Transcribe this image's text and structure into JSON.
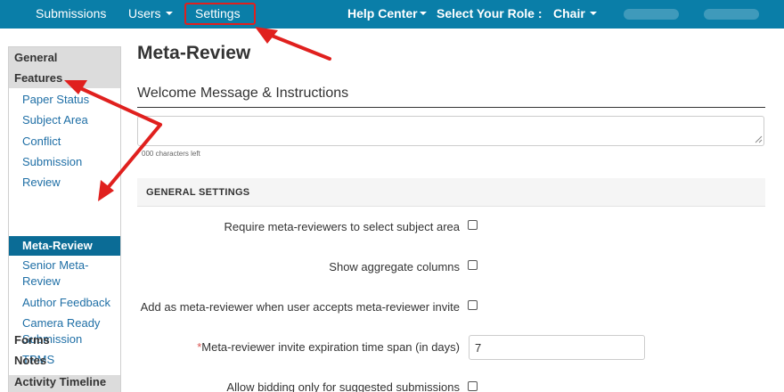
{
  "topnav": {
    "submissions": "Submissions",
    "users": "Users",
    "settings": "Settings",
    "help_center": "Help Center",
    "select_role_label": "Select Your Role :",
    "role": "Chair"
  },
  "sidebar": {
    "general": "General",
    "features": "Features",
    "features_items": [
      "Paper Status",
      "Subject Area",
      "Conflict",
      "Submission",
      "Review",
      "Meta-Review",
      "Senior Meta-Review",
      "Author Feedback",
      "Camera Ready Submission",
      "TPMS"
    ],
    "active_item": "Meta-Review",
    "forms": "Forms",
    "notes": "Notes",
    "activity_timeline": "Activity Timeline"
  },
  "main": {
    "title": "Meta-Review",
    "welcome_heading": "Welcome Message & Instructions",
    "welcome_value": "",
    "chars_left": "000 characters left",
    "section_title": "GENERAL SETTINGS",
    "settings": [
      {
        "label": "Require meta-reviewers to select subject area",
        "checked": false
      },
      {
        "label": "Show aggregate columns",
        "checked": false
      },
      {
        "label": "Add as meta-reviewer when user accepts meta-reviewer invite",
        "checked": false
      },
      {
        "required_mark": "*",
        "label": "Meta-reviewer invite expiration time span (in days)",
        "value": "7"
      },
      {
        "label": "Allow bidding only for suggested submissions",
        "checked": false
      }
    ]
  },
  "colors": {
    "navbar": "#0a7ea8",
    "sidebar_active": "#0b6c96",
    "link": "#1f6fa6",
    "annotation": "#e0201e"
  }
}
